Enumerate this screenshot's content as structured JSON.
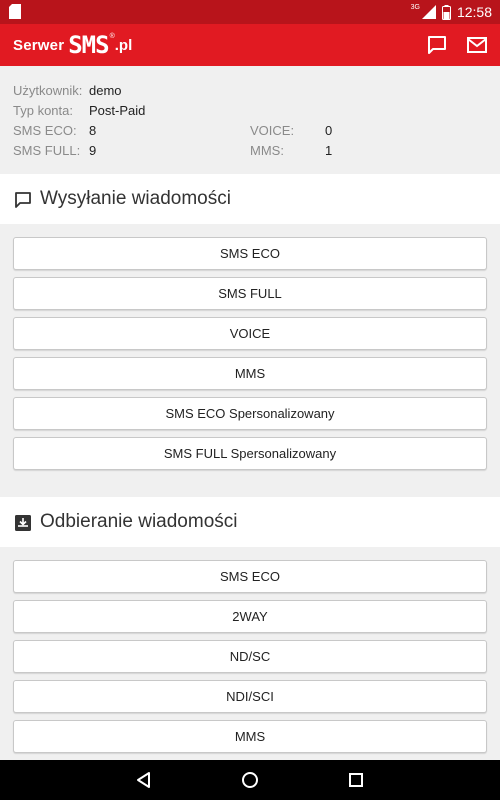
{
  "status_bar": {
    "network_label": "3G",
    "time": "12:58",
    "icons": [
      "sd-card-icon",
      "signal-icon",
      "battery-icon"
    ]
  },
  "app_bar": {
    "logo_prefix": "Serwer",
    "logo_main": "SMS",
    "logo_reg": "®",
    "logo_suffix": ".pl",
    "actions": [
      "chat-icon",
      "mail-icon"
    ],
    "colors": {
      "bar": "#e11a22",
      "status": "#b8141b"
    }
  },
  "account": {
    "user_label": "Użytkownik:",
    "user_value": "demo",
    "type_label": "Typ konta:",
    "type_value": "Post-Paid",
    "sms_eco_label": "SMS ECO:",
    "sms_eco_value": "8",
    "sms_full_label": "SMS FULL:",
    "sms_full_value": "9",
    "voice_label": "VOICE:",
    "voice_value": "0",
    "mms_label": "MMS:",
    "mms_value": "1"
  },
  "send_section": {
    "title": "Wysyłanie wiadomości",
    "icon": "chat-bubble-icon",
    "buttons": [
      "SMS ECO",
      "SMS FULL",
      "VOICE",
      "MMS",
      "SMS ECO Spersonalizowany",
      "SMS FULL Spersonalizowany"
    ]
  },
  "receive_section": {
    "title": "Odbieranie wiadomości",
    "icon": "inbox-download-icon",
    "buttons": [
      "SMS ECO",
      "2WAY",
      "ND/SC",
      "NDI/SCI",
      "MMS"
    ]
  },
  "nav_bar": {
    "icons": [
      "back-icon",
      "home-icon",
      "recents-icon"
    ]
  }
}
